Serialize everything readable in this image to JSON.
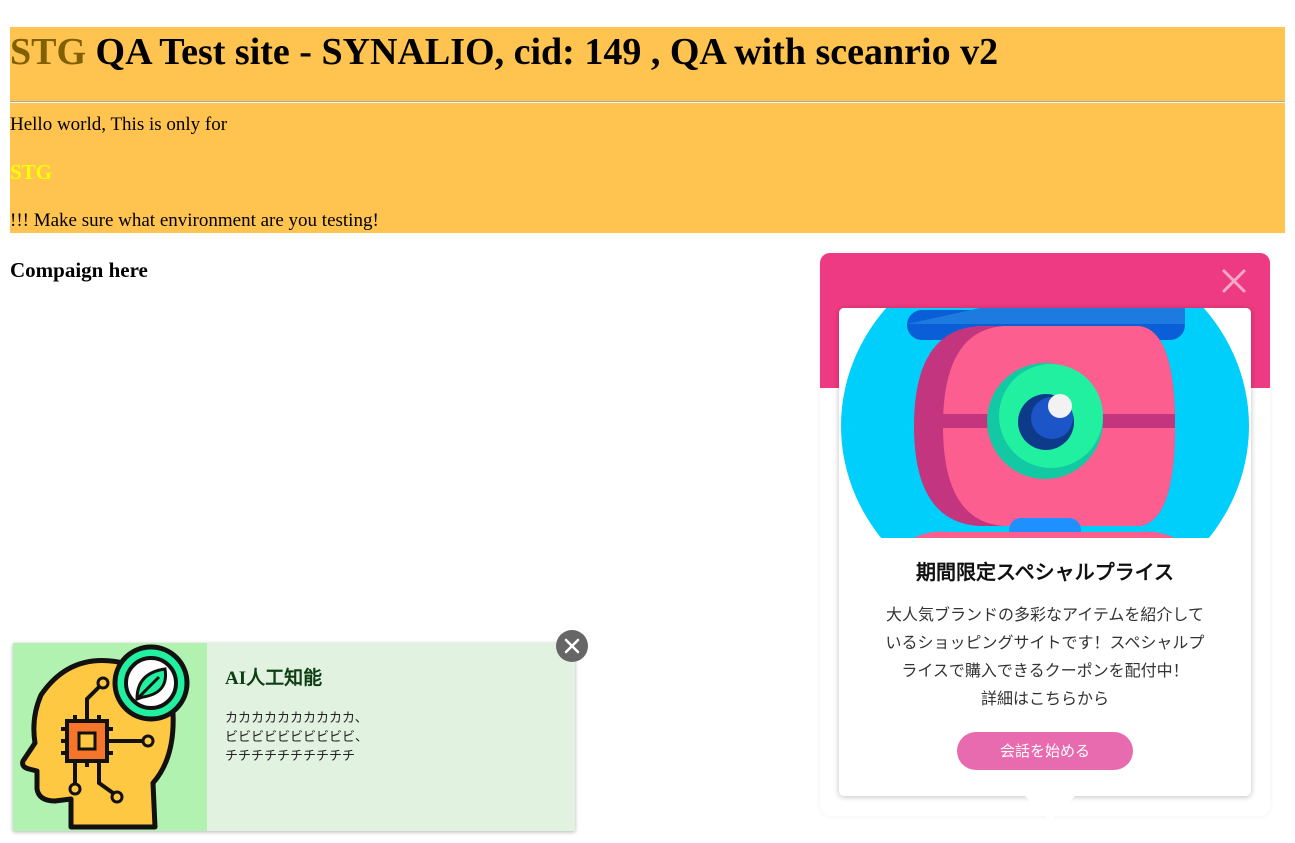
{
  "header": {
    "env_label": "STG",
    "title_rest": " QA Test site - SYNALIO, cid: 149 , QA with sceanrio v2",
    "hello_text": "Hello world, This is only for",
    "env_strong": "STG",
    "warning_text": "!!! Make sure what environment are you testing!"
  },
  "main": {
    "campaign_heading": "Compaign here"
  },
  "popup": {
    "close_icon": "close-icon",
    "image": "robot-eye-illustration",
    "heading": "期間限定スペシャルプライス",
    "body_lines": [
      "大人気ブランドの多彩なアイテムを紹介して",
      "いるショッピングサイトです！スペシャルプ",
      "ライスで購入できるクーポンを配付中！",
      "詳細はこちらから"
    ],
    "cta_label": "会話を始める",
    "colors": {
      "header": "#ee3a82",
      "cta": "#e86aaf"
    }
  },
  "ai_banner": {
    "image": "ai-head-circuit-icon",
    "title": "AI人工知能",
    "lines": [
      "カカカカカカカカカカ、",
      "ビビビビビビビビビビ、",
      "チチチチチチチチチチ"
    ],
    "close_icon": "close-circle-icon"
  },
  "colors": {
    "banner_bg": "#ffc34f",
    "env_label": "#806000",
    "env_strong": "#ffff00"
  }
}
